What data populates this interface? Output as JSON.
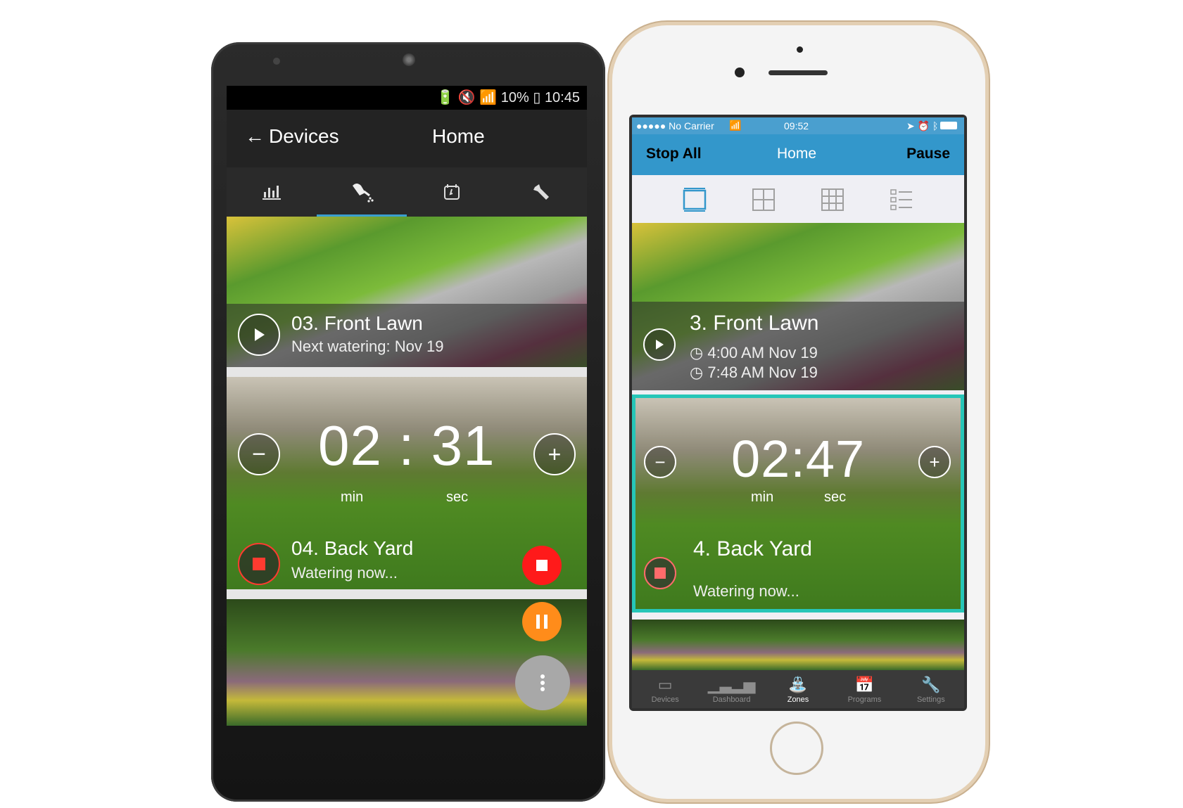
{
  "android": {
    "status_bar": {
      "icons": [
        "battery-saver-icon",
        "mute-icon",
        "wifi-icon",
        "signal-icon"
      ],
      "battery": "10%",
      "time": "10:45"
    },
    "app_bar": {
      "back_label": "Devices",
      "title": "Home"
    },
    "tabs": [
      {
        "icon": "dashboard-icon",
        "glyph": "📊"
      },
      {
        "icon": "watering-can-icon",
        "glyph": "⛲",
        "active": true
      },
      {
        "icon": "programs-calendar-icon",
        "glyph": "🗓"
      },
      {
        "icon": "wrench-settings-icon",
        "glyph": "🔧"
      }
    ],
    "zones": [
      {
        "name": "03. Front Lawn",
        "subtitle": "Next watering: Nov 19",
        "action": "play"
      },
      {
        "name": "04. Back Yard",
        "subtitle": "Watering now...",
        "action": "stop",
        "timer": {
          "minutes": "02",
          "seconds": "31",
          "min_label": "min",
          "sec_label": "sec"
        }
      }
    ],
    "fabs": {
      "stop_color": "#ff1a1a",
      "pause_color": "#ff8c1a",
      "menu_color": "#a8a8a8"
    }
  },
  "iphone": {
    "status_bar": {
      "carrier": "●●●●● No Carrier",
      "time": "09:52"
    },
    "nav": {
      "left": "Stop All",
      "title": "Home",
      "right": "Pause"
    },
    "view_modes": [
      "single-view-icon",
      "grid-2x2-icon",
      "grid-3x3-icon",
      "list-view-icon"
    ],
    "zones": [
      {
        "name": "3. Front Lawn",
        "schedule": [
          "4:00 AM Nov 19",
          "7:48 AM Nov 19"
        ],
        "action": "play"
      },
      {
        "name": "4. Back Yard",
        "subtitle": "Watering now...",
        "action": "stop",
        "timer": {
          "minutes": "02",
          "seconds": "47",
          "min_label": "min",
          "sec_label": "sec"
        }
      }
    ],
    "tabbar": [
      {
        "label": "Devices",
        "icon": "devices-icon"
      },
      {
        "label": "Dashboard",
        "icon": "dashboard-icon"
      },
      {
        "label": "Zones",
        "icon": "watering-can-icon",
        "active": true
      },
      {
        "label": "Programs",
        "icon": "programs-calendar-icon"
      },
      {
        "label": "Settings",
        "icon": "wrench-settings-icon"
      }
    ],
    "highlight_color": "#26c6b8",
    "accent_color": "#3397cb"
  }
}
